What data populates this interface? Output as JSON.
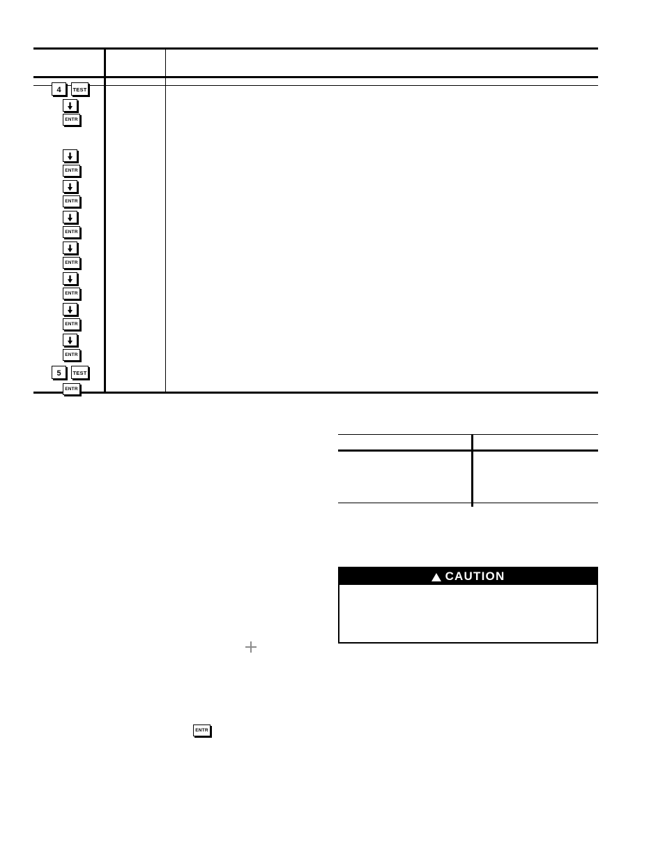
{
  "document": {
    "page_background": "#ffffff",
    "ink_color": "#000000"
  },
  "procedure_table": {
    "name": "procedure-table",
    "header_row": {
      "col1": "",
      "col2": "",
      "col3": ""
    },
    "subheader_row": {
      "col1": "",
      "col2": "",
      "col3": ""
    },
    "body_row": {
      "col2": "",
      "col3": ""
    },
    "keypress_sequence": [
      {
        "type": "pair",
        "keys": [
          {
            "label": "4",
            "kind": "number"
          },
          {
            "label": "TEST",
            "kind": "test"
          }
        ]
      },
      {
        "type": "single",
        "keys": [
          {
            "label": "↓",
            "kind": "arrow"
          }
        ]
      },
      {
        "type": "single",
        "keys": [
          {
            "label": "ENTR",
            "kind": "entr"
          }
        ]
      },
      {
        "type": "gap"
      },
      {
        "type": "single",
        "keys": [
          {
            "label": "↓",
            "kind": "arrow"
          }
        ]
      },
      {
        "type": "single",
        "keys": [
          {
            "label": "ENTR",
            "kind": "entr"
          }
        ]
      },
      {
        "type": "single",
        "keys": [
          {
            "label": "↓",
            "kind": "arrow"
          }
        ]
      },
      {
        "type": "single",
        "keys": [
          {
            "label": "ENTR",
            "kind": "entr"
          }
        ]
      },
      {
        "type": "single",
        "keys": [
          {
            "label": "↓",
            "kind": "arrow"
          }
        ]
      },
      {
        "type": "single",
        "keys": [
          {
            "label": "ENTR",
            "kind": "entr"
          }
        ]
      },
      {
        "type": "single",
        "keys": [
          {
            "label": "↓",
            "kind": "arrow"
          }
        ]
      },
      {
        "type": "single",
        "keys": [
          {
            "label": "ENTR",
            "kind": "entr"
          }
        ]
      },
      {
        "type": "single",
        "keys": [
          {
            "label": "↓",
            "kind": "arrow"
          }
        ]
      },
      {
        "type": "single",
        "keys": [
          {
            "label": "ENTR",
            "kind": "entr"
          }
        ]
      },
      {
        "type": "single",
        "keys": [
          {
            "label": "↓",
            "kind": "arrow"
          }
        ]
      },
      {
        "type": "single",
        "keys": [
          {
            "label": "ENTR",
            "kind": "entr"
          }
        ]
      },
      {
        "type": "single",
        "keys": [
          {
            "label": "↓",
            "kind": "arrow"
          }
        ]
      },
      {
        "type": "single",
        "keys": [
          {
            "label": "ENTR",
            "kind": "entr"
          }
        ]
      },
      {
        "type": "pair",
        "keys": [
          {
            "label": "5",
            "kind": "number"
          },
          {
            "label": "TEST",
            "kind": "test"
          }
        ]
      },
      {
        "type": "single",
        "keys": [
          {
            "label": "ENTR",
            "kind": "entr"
          }
        ]
      }
    ]
  },
  "spec_table": {
    "name": "spec-table",
    "header_row": {
      "col1": "",
      "col2": ""
    },
    "body_row": {
      "col1": "",
      "col2": ""
    }
  },
  "caution": {
    "name": "caution-box",
    "title": "CAUTION",
    "icon": "warning-triangle-icon",
    "body_text": ""
  },
  "marks": {
    "crosshair": "crosshair-registration-mark",
    "standalone_key": {
      "label": "ENTR",
      "kind": "entr"
    }
  }
}
